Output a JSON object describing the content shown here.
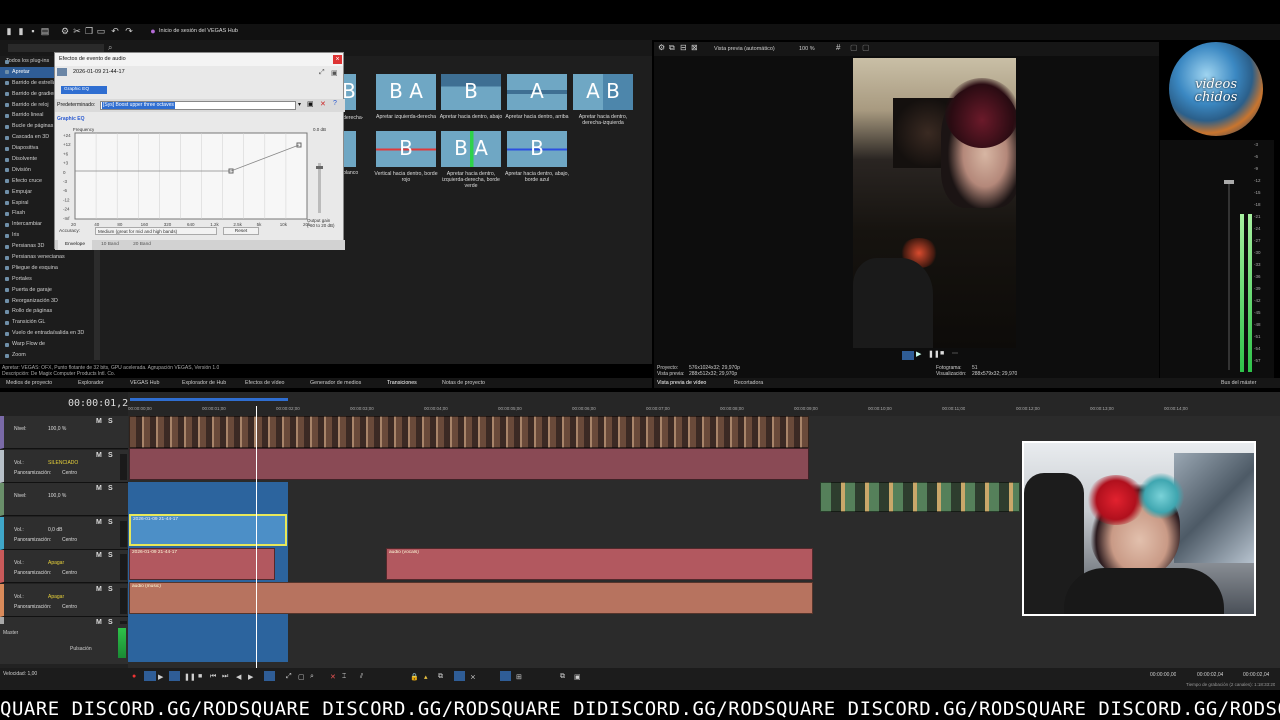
{
  "vegas_hub": "Inicio de sesión del VEGAS Hub",
  "fx_list": {
    "header": "Todos los plug-ins",
    "items": [
      "Apretar",
      "Barrido de estrella",
      "Barrido de gradiente",
      "Barrido de reloj",
      "Barrido lineal",
      "Bucle de páginas",
      "Cascada en 3D",
      "Diapositiva",
      "Disolvente",
      "División",
      "Efecto cruce",
      "Empujar",
      "Espiral",
      "Flash",
      "Intercambiar",
      "Iris",
      "Persianas 3D",
      "Persianas venecianas",
      "Pliegue de esquina",
      "Portales",
      "Puerta de garaje",
      "Reorganización 3D",
      "Rollo de páginas",
      "Transición GL",
      "Vuelo de entrada/salida en 3D",
      "Warp Flow de",
      "Zoom"
    ],
    "selected_index": 0
  },
  "status_lines": [
    "Apretar: VEGAS: OFX, Punto flotante de 32 bits, GPU acelerada. Agrupación VEGAS, Versión 1.0",
    "Descripción: De Magix Computer Products Intl. Co."
  ],
  "dialog": {
    "title": "Efectos de evento de audio",
    "event": "2026-01-09 21-44-17",
    "chain_item": "Graphic EQ",
    "preset_label": "Predeterminado:",
    "preset_value": "[Sys] Boost upper three octaves",
    "eq_title": "Graphic EQ",
    "eq_frequency": "Frequency",
    "eq_db_labels": [
      "+24",
      "+12",
      "+6",
      "+3",
      "0",
      "-3",
      "-6",
      "-12",
      "-24",
      "-Inf"
    ],
    "eq_db_top": "0.0 dB",
    "eq_freq_labels": [
      "20",
      "40",
      "80",
      "160",
      "320",
      "640",
      "1.2k",
      "2.5k",
      "5k",
      "10k",
      "20k"
    ],
    "output_gain": "Output gain\n(-60 to 20 dB)",
    "accuracy_label": "Accuracy:",
    "accuracy_value": "Medium (great for mid and high bands)",
    "reset": "Reset",
    "tabs": [
      "Envelope",
      "10 Band",
      "20 Band"
    ]
  },
  "transitions": [
    {
      "letters": "B",
      "caption": ""
    },
    {
      "letters": "B A",
      "caption": "Apretar izquierda-derecha"
    },
    {
      "letters": "B",
      "caption": "Apretar hacia dentro, abajo"
    },
    {
      "letters": "A",
      "caption": "Apretar hacia dentro, arriba"
    },
    {
      "letters": "A B",
      "caption": "Apretar hacia dentro, derecha-izquierda"
    },
    {
      "letters": "",
      "caption": ""
    },
    {
      "letters": "B",
      "caption": "Vertical hacia dentro, borde rojo"
    },
    {
      "letters": "B A",
      "caption": "Apretar hacia dentro, izquierda-derecha, borde verde"
    },
    {
      "letters": "B",
      "caption": "Apretar hacia dentro, abajo, borde azul"
    }
  ],
  "transition_side_captions": [
    "derecha-",
    "blanco"
  ],
  "preview": {
    "mode": "Vista previa (automático)",
    "zoom": "100 %",
    "info_left": [
      "Proyecto:",
      "Vista previa:"
    ],
    "info_left_values": [
      "576x1024x32; 29,970p",
      "288x512x32; 29,970p"
    ],
    "info_right": [
      "Fotograma:",
      "Visualización:"
    ],
    "info_right_values": [
      "51",
      "288x579x32; 29,970"
    ]
  },
  "meter": {
    "labels": [
      "-3",
      "-6",
      "-9",
      "-12",
      "-15",
      "-18",
      "-21",
      "-24",
      "-27",
      "-30",
      "-33",
      "-36",
      "-39",
      "-42",
      "-45",
      "-48",
      "-51",
      "-54",
      "-57"
    ]
  },
  "channel_logo": "videos chidos",
  "tabs_left": [
    "Medios de proyecto",
    "Explorador",
    "VEGAS Hub",
    "Explorador de Hub",
    "Efectos de vídeo",
    "Generador de medios",
    "Transiciones",
    "Notas de proyecto"
  ],
  "tabs_preview": [
    "Vista previa de vídeo",
    "Recortadora"
  ],
  "tab_master": "Bus del máster",
  "timeline": {
    "timecode": "00:00:01,22",
    "ruler": [
      "00:00:00;00",
      "00:00:01;00",
      "00:00:02;00",
      "00:00:03;00",
      "00:00:04;00",
      "00:00:05;00",
      "00:00:06;00",
      "00:00:07;00",
      "00:00:08;00",
      "00:00:09;00",
      "00:00:10;00",
      "00:00:11;00",
      "00:00:12;00",
      "00:00:13;00",
      "00:00:14;00"
    ],
    "tracks": [
      {
        "label1": "Nivel:",
        "value1": "100,0 %",
        "type": "video"
      },
      {
        "label1": "Vol.:",
        "value1": "SILENCIADO",
        "label2": "Panoramización:",
        "value2": "Centro",
        "type": "audio"
      },
      {
        "label1": "Nivel:",
        "value1": "100,0 %",
        "type": "video"
      },
      {
        "label1": "Vol.:",
        "value1": "0,0 dB",
        "label2": "Panoramización:",
        "value2": "Centro",
        "type": "audio"
      },
      {
        "label1": "Vol.:",
        "value1": "Apagar",
        "label2": "Panoramización:",
        "value2": "Centro",
        "type": "audio"
      },
      {
        "label1": "Vol.:",
        "value1": "Apagar",
        "label2": "Panoramización:",
        "value2": "Centro",
        "type": "audio"
      },
      {
        "label1": "new audio track",
        "value1": "",
        "type": "audio"
      }
    ],
    "meter_nums": [
      "27",
      "36",
      "45",
      "54",
      "108"
    ],
    "clip_labels": [
      "2026-01-09 21-44-17",
      "2026-01-09 21-44-17",
      "audio (vocals)",
      "audio (music)"
    ],
    "master": "Master",
    "pulsacion": "Pulsación",
    "velocidad": "Velocidad: 1,00",
    "transport_times": [
      "00:00:00,00",
      "00:00:02,04",
      "00:00:02,04"
    ],
    "rec_time": "Tiempo de grabación (2 canales): 1:18:33:20"
  },
  "ticker": "QUARE DISCORD.GG/RODSQUARE DISCORD.GG/RODSQUARE DIDISCORD.GG/RODSQUARE DISCORD.GG/RODSQUARE DISCORD.GG/RODSQUARE DISCORD.GG/RODS",
  "colors": {
    "accent": "#2f5d96",
    "audio_clip": "#b2585f",
    "video_clip": "#8a4a55",
    "music_clip": "#b7735f",
    "selected_clip": "#4c8fc7",
    "meter_green": "#2ec24a"
  }
}
